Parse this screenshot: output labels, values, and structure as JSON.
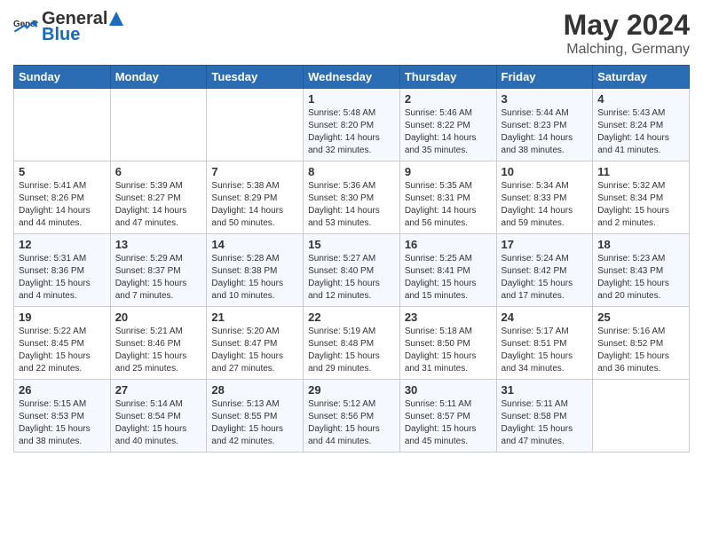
{
  "header": {
    "logo_general": "General",
    "logo_blue": "Blue",
    "month_year": "May 2024",
    "location": "Malching, Germany"
  },
  "days_of_week": [
    "Sunday",
    "Monday",
    "Tuesday",
    "Wednesday",
    "Thursday",
    "Friday",
    "Saturday"
  ],
  "weeks": [
    [
      {
        "day": "",
        "sunrise": "",
        "sunset": "",
        "daylight": ""
      },
      {
        "day": "",
        "sunrise": "",
        "sunset": "",
        "daylight": ""
      },
      {
        "day": "",
        "sunrise": "",
        "sunset": "",
        "daylight": ""
      },
      {
        "day": "1",
        "sunrise": "Sunrise: 5:48 AM",
        "sunset": "Sunset: 8:20 PM",
        "daylight": "Daylight: 14 hours and 32 minutes."
      },
      {
        "day": "2",
        "sunrise": "Sunrise: 5:46 AM",
        "sunset": "Sunset: 8:22 PM",
        "daylight": "Daylight: 14 hours and 35 minutes."
      },
      {
        "day": "3",
        "sunrise": "Sunrise: 5:44 AM",
        "sunset": "Sunset: 8:23 PM",
        "daylight": "Daylight: 14 hours and 38 minutes."
      },
      {
        "day": "4",
        "sunrise": "Sunrise: 5:43 AM",
        "sunset": "Sunset: 8:24 PM",
        "daylight": "Daylight: 14 hours and 41 minutes."
      }
    ],
    [
      {
        "day": "5",
        "sunrise": "Sunrise: 5:41 AM",
        "sunset": "Sunset: 8:26 PM",
        "daylight": "Daylight: 14 hours and 44 minutes."
      },
      {
        "day": "6",
        "sunrise": "Sunrise: 5:39 AM",
        "sunset": "Sunset: 8:27 PM",
        "daylight": "Daylight: 14 hours and 47 minutes."
      },
      {
        "day": "7",
        "sunrise": "Sunrise: 5:38 AM",
        "sunset": "Sunset: 8:29 PM",
        "daylight": "Daylight: 14 hours and 50 minutes."
      },
      {
        "day": "8",
        "sunrise": "Sunrise: 5:36 AM",
        "sunset": "Sunset: 8:30 PM",
        "daylight": "Daylight: 14 hours and 53 minutes."
      },
      {
        "day": "9",
        "sunrise": "Sunrise: 5:35 AM",
        "sunset": "Sunset: 8:31 PM",
        "daylight": "Daylight: 14 hours and 56 minutes."
      },
      {
        "day": "10",
        "sunrise": "Sunrise: 5:34 AM",
        "sunset": "Sunset: 8:33 PM",
        "daylight": "Daylight: 14 hours and 59 minutes."
      },
      {
        "day": "11",
        "sunrise": "Sunrise: 5:32 AM",
        "sunset": "Sunset: 8:34 PM",
        "daylight": "Daylight: 15 hours and 2 minutes."
      }
    ],
    [
      {
        "day": "12",
        "sunrise": "Sunrise: 5:31 AM",
        "sunset": "Sunset: 8:36 PM",
        "daylight": "Daylight: 15 hours and 4 minutes."
      },
      {
        "day": "13",
        "sunrise": "Sunrise: 5:29 AM",
        "sunset": "Sunset: 8:37 PM",
        "daylight": "Daylight: 15 hours and 7 minutes."
      },
      {
        "day": "14",
        "sunrise": "Sunrise: 5:28 AM",
        "sunset": "Sunset: 8:38 PM",
        "daylight": "Daylight: 15 hours and 10 minutes."
      },
      {
        "day": "15",
        "sunrise": "Sunrise: 5:27 AM",
        "sunset": "Sunset: 8:40 PM",
        "daylight": "Daylight: 15 hours and 12 minutes."
      },
      {
        "day": "16",
        "sunrise": "Sunrise: 5:25 AM",
        "sunset": "Sunset: 8:41 PM",
        "daylight": "Daylight: 15 hours and 15 minutes."
      },
      {
        "day": "17",
        "sunrise": "Sunrise: 5:24 AM",
        "sunset": "Sunset: 8:42 PM",
        "daylight": "Daylight: 15 hours and 17 minutes."
      },
      {
        "day": "18",
        "sunrise": "Sunrise: 5:23 AM",
        "sunset": "Sunset: 8:43 PM",
        "daylight": "Daylight: 15 hours and 20 minutes."
      }
    ],
    [
      {
        "day": "19",
        "sunrise": "Sunrise: 5:22 AM",
        "sunset": "Sunset: 8:45 PM",
        "daylight": "Daylight: 15 hours and 22 minutes."
      },
      {
        "day": "20",
        "sunrise": "Sunrise: 5:21 AM",
        "sunset": "Sunset: 8:46 PM",
        "daylight": "Daylight: 15 hours and 25 minutes."
      },
      {
        "day": "21",
        "sunrise": "Sunrise: 5:20 AM",
        "sunset": "Sunset: 8:47 PM",
        "daylight": "Daylight: 15 hours and 27 minutes."
      },
      {
        "day": "22",
        "sunrise": "Sunrise: 5:19 AM",
        "sunset": "Sunset: 8:48 PM",
        "daylight": "Daylight: 15 hours and 29 minutes."
      },
      {
        "day": "23",
        "sunrise": "Sunrise: 5:18 AM",
        "sunset": "Sunset: 8:50 PM",
        "daylight": "Daylight: 15 hours and 31 minutes."
      },
      {
        "day": "24",
        "sunrise": "Sunrise: 5:17 AM",
        "sunset": "Sunset: 8:51 PM",
        "daylight": "Daylight: 15 hours and 34 minutes."
      },
      {
        "day": "25",
        "sunrise": "Sunrise: 5:16 AM",
        "sunset": "Sunset: 8:52 PM",
        "daylight": "Daylight: 15 hours and 36 minutes."
      }
    ],
    [
      {
        "day": "26",
        "sunrise": "Sunrise: 5:15 AM",
        "sunset": "Sunset: 8:53 PM",
        "daylight": "Daylight: 15 hours and 38 minutes."
      },
      {
        "day": "27",
        "sunrise": "Sunrise: 5:14 AM",
        "sunset": "Sunset: 8:54 PM",
        "daylight": "Daylight: 15 hours and 40 minutes."
      },
      {
        "day": "28",
        "sunrise": "Sunrise: 5:13 AM",
        "sunset": "Sunset: 8:55 PM",
        "daylight": "Daylight: 15 hours and 42 minutes."
      },
      {
        "day": "29",
        "sunrise": "Sunrise: 5:12 AM",
        "sunset": "Sunset: 8:56 PM",
        "daylight": "Daylight: 15 hours and 44 minutes."
      },
      {
        "day": "30",
        "sunrise": "Sunrise: 5:11 AM",
        "sunset": "Sunset: 8:57 PM",
        "daylight": "Daylight: 15 hours and 45 minutes."
      },
      {
        "day": "31",
        "sunrise": "Sunrise: 5:11 AM",
        "sunset": "Sunset: 8:58 PM",
        "daylight": "Daylight: 15 hours and 47 minutes."
      },
      {
        "day": "",
        "sunrise": "",
        "sunset": "",
        "daylight": ""
      }
    ]
  ]
}
